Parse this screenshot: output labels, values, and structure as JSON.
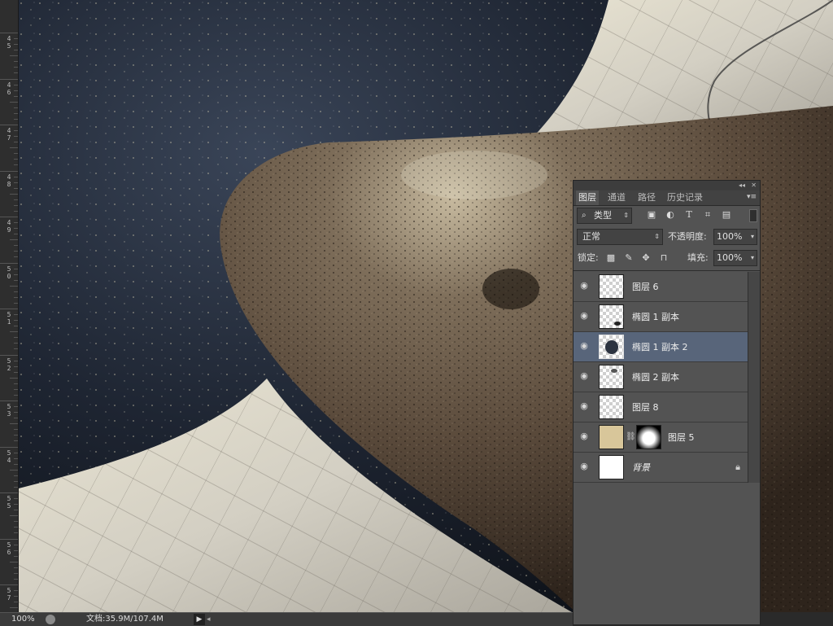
{
  "ruler": {
    "labels": [
      "4\n5",
      "4\n6",
      "4\n7",
      "4\n8",
      "4\n9",
      "5\n0",
      "5\n1",
      "5\n2",
      "5\n3",
      "5\n4",
      "5\n5",
      "5\n6",
      "5\n7"
    ]
  },
  "statusbar": {
    "zoom": "100%",
    "doc_info": "文档:35.9M/107.4M",
    "arrow": "▶",
    "scroll_arrow": "◂"
  },
  "layers_panel": {
    "collapse_arrows": "◂◂",
    "close": "✕",
    "tabs": [
      {
        "label": "图层",
        "active": true
      },
      {
        "label": "通道",
        "active": false
      },
      {
        "label": "路径",
        "active": false
      },
      {
        "label": "历史记录",
        "active": false
      }
    ],
    "filter": {
      "label": "类型",
      "icons": [
        "image-filter-icon",
        "adjustment-filter-icon",
        "type-filter-icon",
        "shape-filter-icon",
        "smart-object-filter-icon"
      ]
    },
    "blend_mode": "正常",
    "opacity_label": "不透明度:",
    "opacity_value": "100%",
    "lock_label": "锁定:",
    "fill_label": "填充:",
    "fill_value": "100%",
    "layers": [
      {
        "name": "图层 6",
        "thumb": "transparent",
        "selected": false
      },
      {
        "name": "椭圆 1 副本",
        "thumb": "transparent-small",
        "selected": false
      },
      {
        "name": "椭圆 1 副本 2",
        "thumb": "transparent-dark",
        "selected": true
      },
      {
        "name": "椭圆 2 副本",
        "thumb": "transparent-small",
        "selected": false
      },
      {
        "name": "图层 8",
        "thumb": "transparent",
        "selected": false
      },
      {
        "name": "图层 5",
        "thumb": "paper-with-mask",
        "selected": false
      },
      {
        "name": "背景",
        "thumb": "white",
        "selected": false,
        "locked": true
      }
    ]
  },
  "colors": {
    "panel_bg": "#535353",
    "selected_layer": "#58657a",
    "canvas_dark": "#141a24",
    "canvas_brown": "#5b4b3d",
    "canvas_paper": "#cfcbbd"
  }
}
